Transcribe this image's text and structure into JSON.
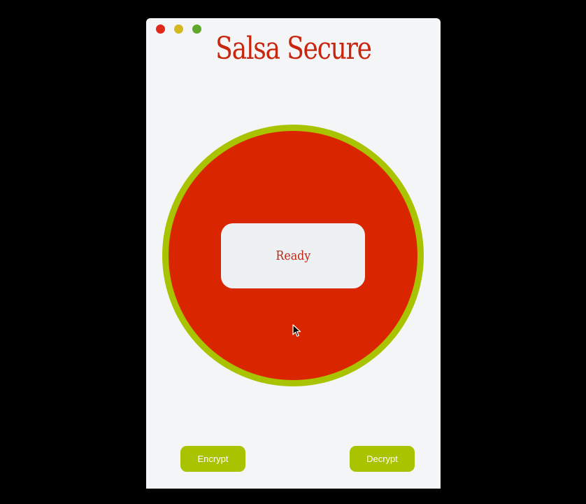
{
  "window": {
    "traffic_lights": [
      {
        "name": "close",
        "color": "#e0281a"
      },
      {
        "name": "minimize",
        "color": "#d4b81f"
      },
      {
        "name": "zoom",
        "color": "#5fa82c"
      }
    ]
  },
  "app": {
    "title": "Salsa Secure"
  },
  "status": {
    "text": "Ready"
  },
  "buttons": {
    "encrypt_label": "Encrypt",
    "decrypt_label": "Decrypt"
  },
  "colors": {
    "title": "#c9260f",
    "disc": "#d92600",
    "ring": "#a9c300",
    "card": "#eef1f4",
    "status_text": "#c02712",
    "button": "#a9c300",
    "window_bg": "#f4f5f7"
  },
  "cursor": {
    "icon": "mouse-pointer-icon"
  }
}
